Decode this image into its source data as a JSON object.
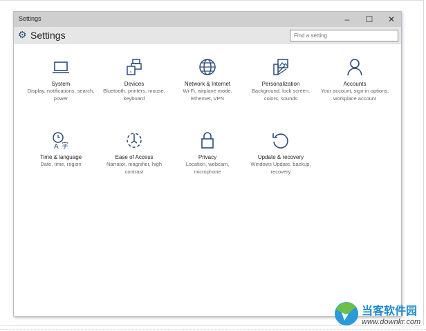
{
  "window": {
    "title": "Settings",
    "minimize": "–",
    "maximize": "☐",
    "close": "✕"
  },
  "header": {
    "title": "Settings",
    "search_placeholder": "Find a setting"
  },
  "tiles": [
    {
      "name": "System",
      "desc": "Display, notifications, search, power",
      "icon": "laptop-icon"
    },
    {
      "name": "Devices",
      "desc": "Bluetooth, printers, mouse, keyboard",
      "icon": "devices-icon"
    },
    {
      "name": "Network & Internet",
      "desc": "Wi-Fi, airplane mode, Ethernet, VPN",
      "icon": "globe-icon"
    },
    {
      "name": "Personalization",
      "desc": "Background, lock screen, colors, sounds",
      "icon": "personalization-icon"
    },
    {
      "name": "Accounts",
      "desc": "Your account, sign-in options, workplace account",
      "icon": "person-icon"
    },
    {
      "name": "Time & language",
      "desc": "Date, time, region",
      "icon": "time-language-icon"
    },
    {
      "name": "Ease of Access",
      "desc": "Narrator, magnifier, high contrast",
      "icon": "ease-of-access-icon"
    },
    {
      "name": "Privacy",
      "desc": "Location, webcam, microphone",
      "icon": "lock-icon"
    },
    {
      "name": "Update & recovery",
      "desc": "Windows Update, backup, recovery",
      "icon": "refresh-icon"
    }
  ],
  "watermark": {
    "cn": "当客软件园",
    "url": "www.downkr.com"
  },
  "colors": {
    "accent": "#2b4a7a"
  }
}
